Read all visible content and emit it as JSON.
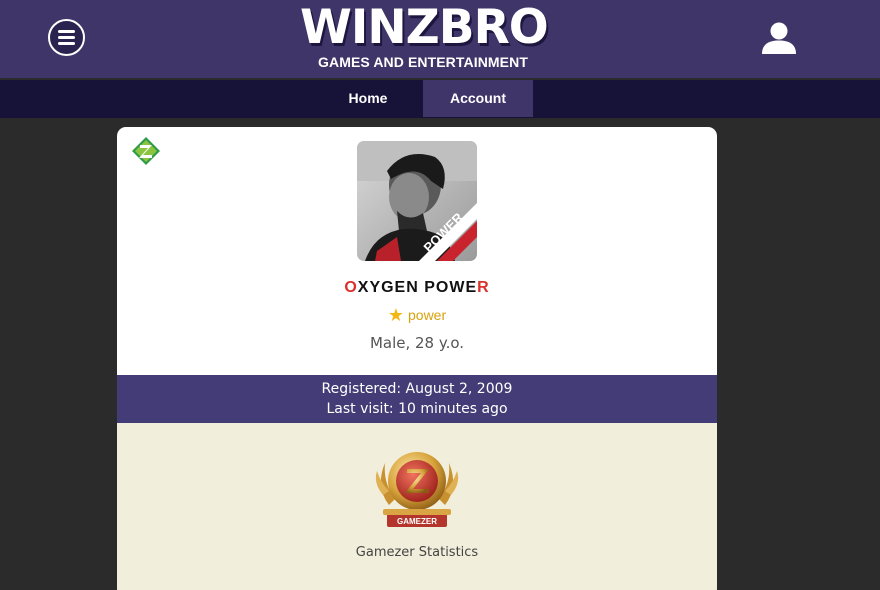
{
  "header": {
    "logo_title": "WINZBRO",
    "logo_subtitle": "GAMES AND ENTERTAINMENT",
    "menu_icon": "hamburger-menu-icon",
    "user_icon": "user-icon"
  },
  "nav": {
    "items": [
      {
        "label": "Home"
      },
      {
        "label": "Account",
        "active": true
      }
    ]
  },
  "profile": {
    "name_first": "O",
    "name_mid": "XYGEN POWE",
    "name_last": "R",
    "status": "power",
    "info": "Male, 28 y.o.",
    "avatar_caption": "POWER",
    "registered": "Registered: August 2, 2009",
    "last_visit": "Last visit: 10 minutes ago"
  },
  "stats": {
    "badge_text": "GAMEZER",
    "label": "Gamezer Statistics"
  },
  "colors": {
    "header_bg": "#3f3569",
    "nav_bg": "#171238",
    "accent_red": "#d9312c",
    "status_gold": "#d8a20c",
    "info_band": "#433c76",
    "stats_bg": "#f1eedb"
  }
}
